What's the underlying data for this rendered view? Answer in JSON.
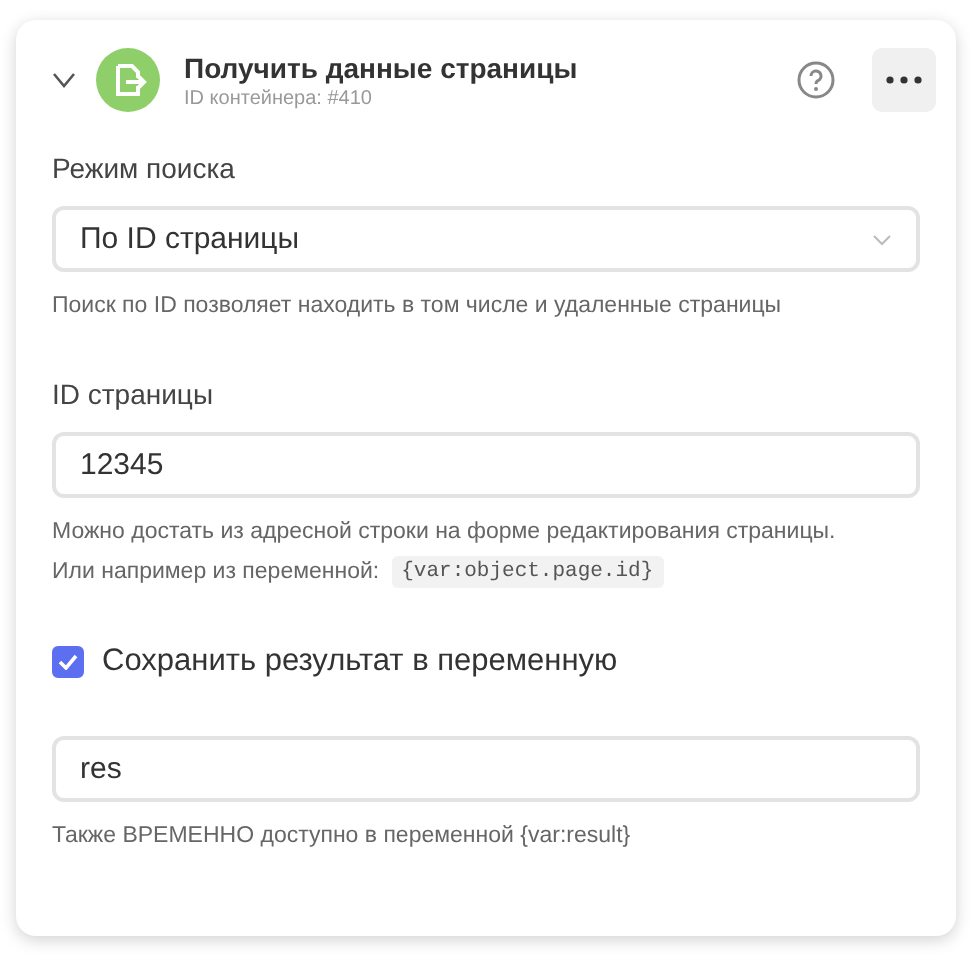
{
  "header": {
    "expanded": true,
    "title": "Получить данные страницы",
    "subtitle": "ID контейнера: #410"
  },
  "fields": [
    {
      "kind": "select",
      "label": "Режим поиска",
      "value": "По ID страницы",
      "hints": [
        {
          "text": "Поиск по ID позволяет находить в том числе и удаленные страницы"
        }
      ]
    },
    {
      "kind": "input",
      "label": "ID страницы",
      "value": "12345",
      "hints": [
        {
          "text": "Можно достать из адресной строки на форме редактирования страницы."
        },
        {
          "text": "Или например из переменной:",
          "code": "{var:object.page.id}"
        }
      ]
    },
    {
      "kind": "checkbox",
      "label": "Сохранить результат в переменную",
      "checked": true
    },
    {
      "kind": "input",
      "value": "res",
      "hints": [
        {
          "text": "Также ВРЕМЕННО доступно в переменной {var:result}"
        }
      ]
    }
  ]
}
